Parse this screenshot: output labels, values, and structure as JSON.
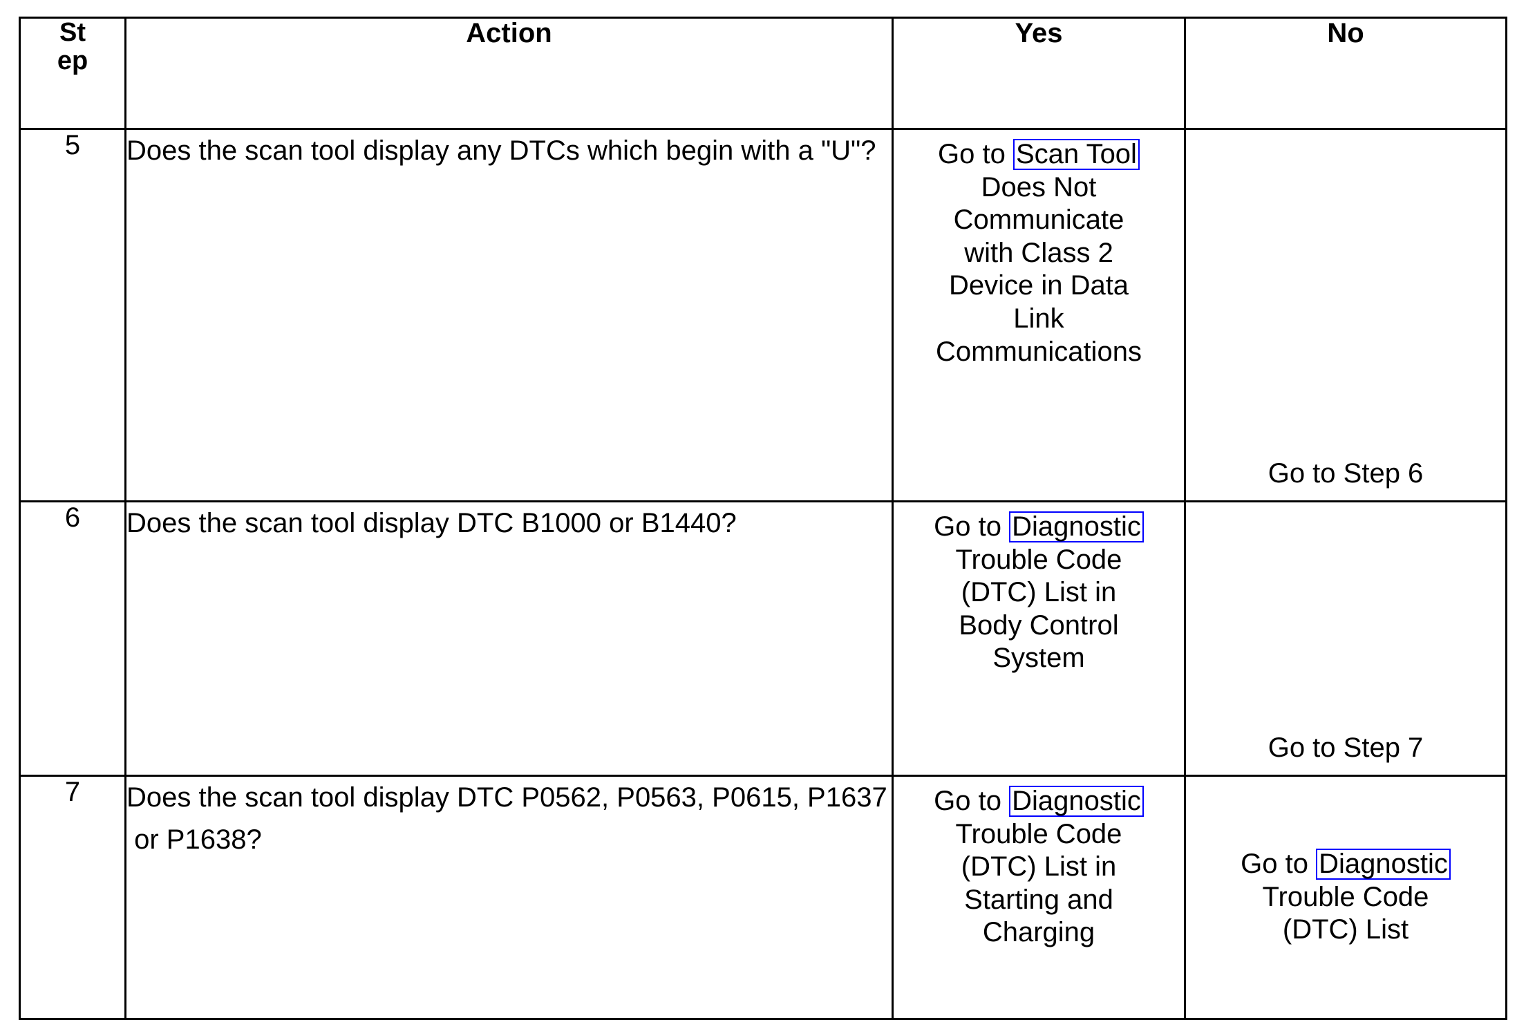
{
  "table": {
    "headers": {
      "step_line1": "St",
      "step_line2": "ep",
      "action": "Action",
      "yes": "Yes",
      "no": "No"
    },
    "link_color": "#0000FF",
    "border_color": "#000000",
    "rows": [
      {
        "step": "5",
        "action_lines": [
          "Does the scan tool display any DTCs which begin with a \"U\"?"
        ],
        "yes": {
          "lead": "Go to",
          "link": "Scan Tool",
          "rest_lines": [
            "Does Not",
            "Communicate",
            "with Class 2",
            "Device in Data",
            "Link",
            "Communications"
          ]
        },
        "no": {
          "lead": "",
          "link": "",
          "rest_lines": [
            "Go to Step 6"
          ]
        }
      },
      {
        "step": "6",
        "action_lines": [
          "Does the scan tool display DTC B1000 or B1440?"
        ],
        "yes": {
          "lead": "Go to",
          "link": "Diagnostic",
          "rest_lines": [
            "Trouble Code",
            "(DTC) List in",
            "Body Control",
            "System"
          ]
        },
        "no": {
          "lead": "",
          "link": "",
          "rest_lines": [
            "Go to Step 7"
          ]
        }
      },
      {
        "step": "7",
        "action_lines": [
          "Does the scan tool display DTC P0562, P0563, P0615, P1637",
          " or P1638?"
        ],
        "yes": {
          "lead": "Go to",
          "link": "Diagnostic",
          "rest_lines": [
            "Trouble Code",
            "(DTC) List in",
            "Starting and",
            "Charging"
          ]
        },
        "no": {
          "lead": "Go to",
          "link": "Diagnostic",
          "rest_lines": [
            "Trouble Code",
            "(DTC) List"
          ]
        }
      }
    ]
  }
}
